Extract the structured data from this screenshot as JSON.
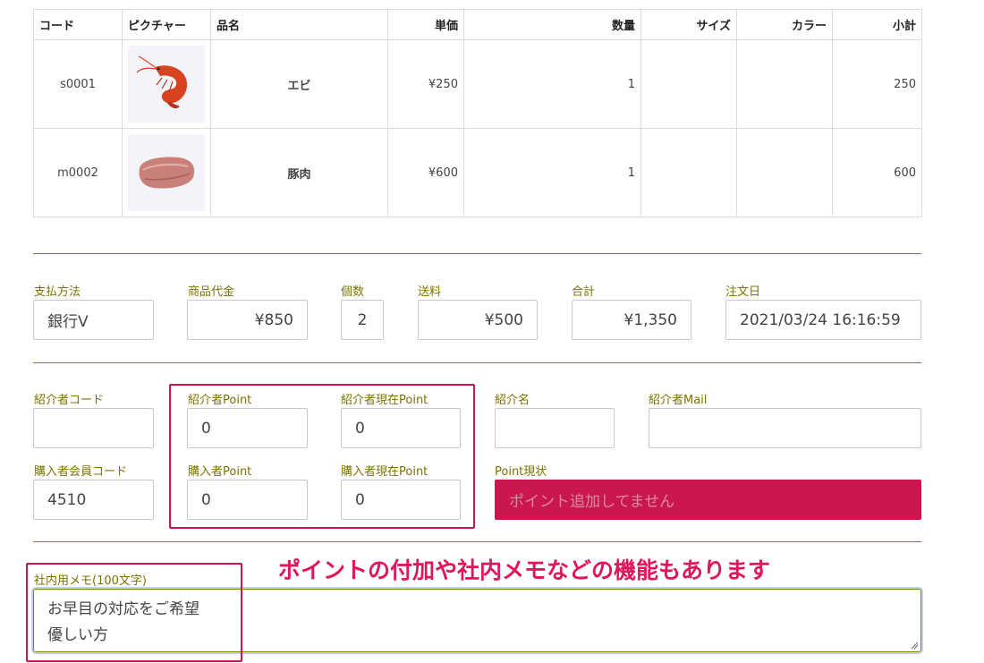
{
  "table": {
    "headers": [
      "コード",
      "ピクチャー",
      "品名",
      "単価",
      "数量",
      "サイズ",
      "カラー",
      "小計"
    ],
    "rows": [
      {
        "code": "s0001",
        "image": "shrimp-photo",
        "name": "エビ",
        "price": "¥250",
        "qty": "1",
        "size": "",
        "color": "",
        "subtotal": "250"
      },
      {
        "code": "m0002",
        "image": "pork-photo",
        "name": "豚肉",
        "price": "¥600",
        "qty": "1",
        "size": "",
        "color": "",
        "subtotal": "600"
      }
    ]
  },
  "summary": {
    "payment_label": "支払方法",
    "payment_value": "銀行V",
    "goods_label": "商品代金",
    "goods_value": "¥850",
    "count_label": "個数",
    "count_value": "2",
    "shipping_label": "送料",
    "shipping_value": "¥500",
    "total_label": "合計",
    "total_value": "¥1,350",
    "date_label": "注文日",
    "date_value": "2021/03/24 16:16:59"
  },
  "referral": {
    "code_label": "紹介者コード",
    "code_value": "",
    "point_label": "紹介者Point",
    "point_value": "0",
    "current_point_label": "紹介者現在Point",
    "current_point_value": "0",
    "name_label": "紹介名",
    "name_value": "",
    "mail_label": "紹介者Mail",
    "mail_value": "",
    "member_label": "購入者会員コード",
    "member_value": "4510",
    "buyer_point_label": "購入者Point",
    "buyer_point_value": "0",
    "buyer_current_label": "購入者現在Point",
    "buyer_current_value": "0",
    "status_label": "Point現状",
    "status_value": "ポイント追加してません"
  },
  "memo": {
    "label": "社内用メモ(100文字)",
    "line1": "お早目の対応をご希望",
    "line2": "優しい方"
  },
  "annotation": "ポイントの付加や社内メモなどの機能もあります",
  "colors": {
    "accent_text": "#7b7300",
    "highlight": "#c01b4f",
    "status_bg": "#cc1650",
    "annotation": "#e1155b"
  }
}
